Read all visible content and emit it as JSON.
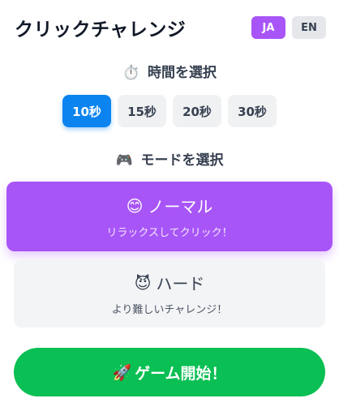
{
  "header": {
    "title": "クリックチャレンジ",
    "languages": [
      {
        "label": "JA",
        "active": true
      },
      {
        "label": "EN",
        "active": false
      }
    ]
  },
  "time_section": {
    "icon": "⏱️",
    "title": "時間を選択",
    "options": [
      {
        "label": "10秒",
        "selected": true
      },
      {
        "label": "15秒",
        "selected": false
      },
      {
        "label": "20秒",
        "selected": false
      },
      {
        "label": "30秒",
        "selected": false
      }
    ]
  },
  "mode_section": {
    "icon": "🎮",
    "title": "モードを選択",
    "modes": [
      {
        "icon": "😊",
        "name": "ノーマル",
        "description": "リラックスしてクリック！",
        "selected": true
      },
      {
        "icon": "😈",
        "name": "ハード",
        "description": "より難しいチャレンジ！",
        "selected": false
      }
    ]
  },
  "start_button": {
    "icon": "🚀",
    "label": "ゲーム開始！"
  },
  "colors": {
    "accent": "#a855f7",
    "selected_time": "#0b84f0",
    "start": "#0abf53"
  }
}
